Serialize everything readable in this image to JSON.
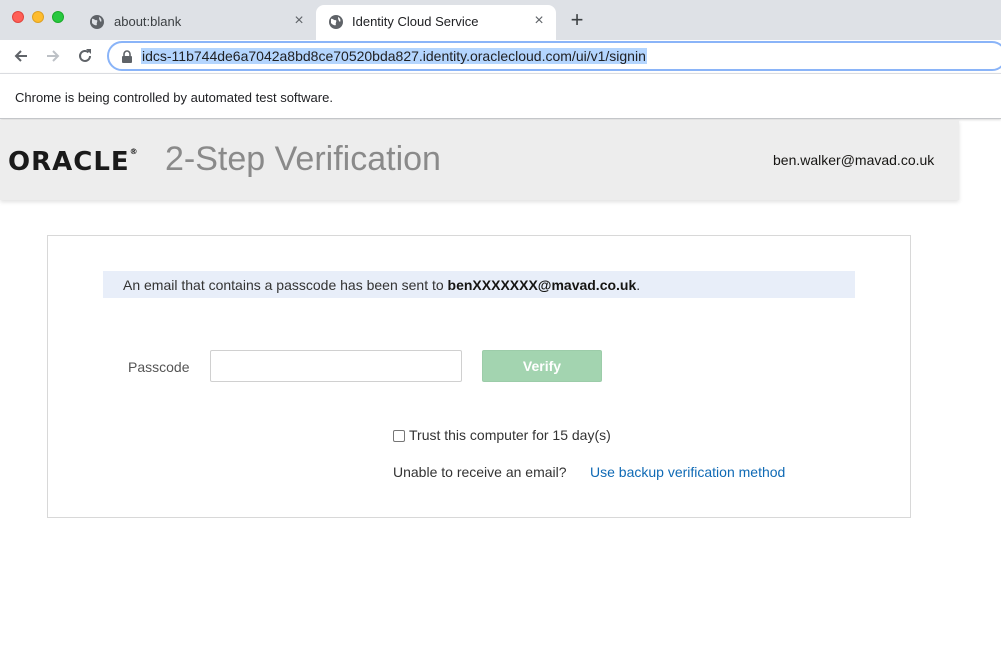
{
  "browser": {
    "tabs": [
      {
        "title": "about:blank",
        "close": "×",
        "active": false
      },
      {
        "title": "Identity Cloud Service",
        "close": "×",
        "active": true
      }
    ],
    "new_tab": "+",
    "url": "idcs-11b744de6a7042a8bd8ce70520bda827.identity.oraclecloud.com/ui/v1/signin",
    "infobar": "Chrome is being controlled by automated test software.",
    "icons": [
      "globe-icon",
      "back-arrow-icon",
      "forward-arrow-icon",
      "reload-icon",
      "lock-icon"
    ]
  },
  "header": {
    "brand": "ORACLE",
    "brand_mark": "®",
    "title": "2-Step Verification",
    "user_email": "ben.walker@mavad.co.uk"
  },
  "verification": {
    "notice_prefix": "An email that contains a passcode has been sent to ",
    "masked_email": "benXXXXXXX@mavad.co.uk",
    "notice_suffix": ".",
    "passcode_label": "Passcode",
    "passcode_value": "",
    "verify_label": "Verify",
    "trust_label": "Trust this computer for 15 day(s)",
    "trust_checked": false,
    "unable_text": "Unable to receive an email?",
    "backup_link": "Use backup verification method"
  },
  "colors": {
    "verify_button": "#a3d4b0",
    "notice_background": "#e8eef9",
    "link": "#0f6ab5",
    "header_background": "#ededed"
  }
}
